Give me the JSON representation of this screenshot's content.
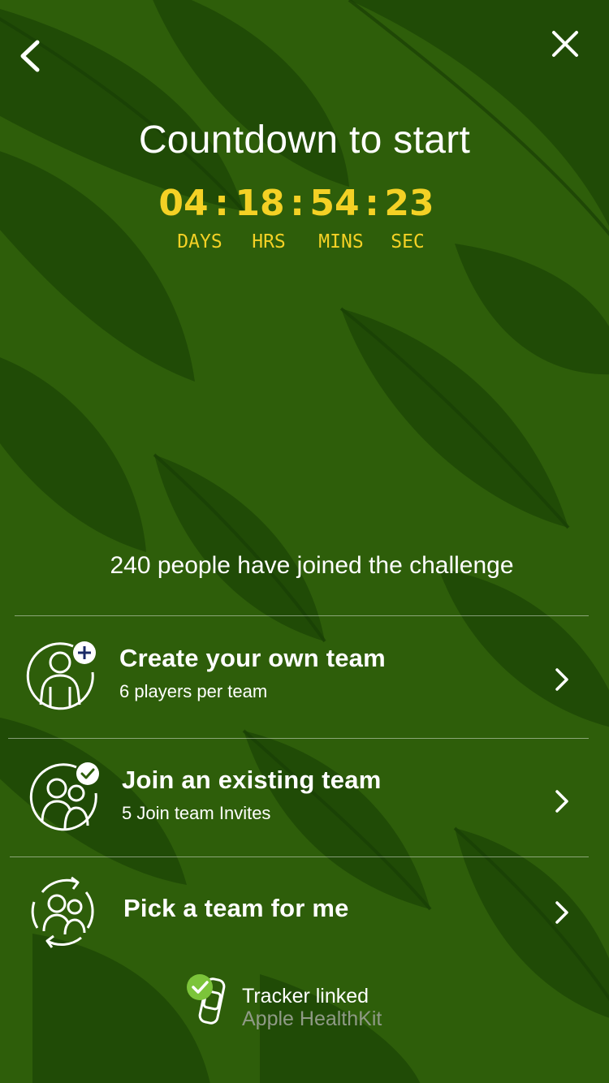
{
  "header": {
    "title": "Countdown to start",
    "back_icon": "chevron-left-icon",
    "close_icon": "close-icon"
  },
  "countdown": {
    "days": "04",
    "hours": "18",
    "minutes": "54",
    "seconds": "23",
    "separator": ":",
    "labels": {
      "days": "DAYS",
      "hours": "HRS",
      "minutes": "MINS",
      "seconds": "SEC"
    },
    "color": "#f4d125"
  },
  "joined_text": "240 people have joined the challenge",
  "options": [
    {
      "title": "Create your own team",
      "subtitle": "6 players per team",
      "icon": "create-team-icon"
    },
    {
      "title": "Join an existing team",
      "subtitle": "5 Join team Invites",
      "icon": "join-team-icon"
    },
    {
      "title": "Pick a team for me",
      "subtitle": "",
      "icon": "pick-team-icon"
    }
  ],
  "tracker": {
    "title": "Tracker linked",
    "source": "Apple HealthKit",
    "icon": "tracker-linked-icon",
    "check_color": "#7cc43a"
  },
  "colors": {
    "background": "#2d5d0a",
    "leaf_dark": "#163d06",
    "accent": "#f4d125",
    "muted_text": "#8f9a86"
  }
}
